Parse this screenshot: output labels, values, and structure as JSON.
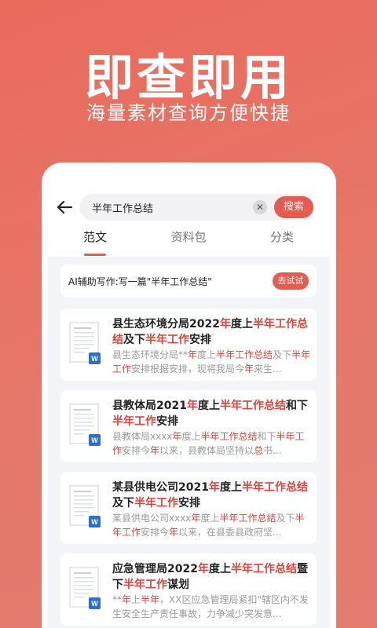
{
  "hero": {
    "title": "即查即用",
    "subtitle": "海量素材查询方便快捷"
  },
  "search": {
    "query": "半年工作总结",
    "clear_icon": "close-icon",
    "button_label": "搜索"
  },
  "tabs": [
    {
      "label": "范文",
      "active": true
    },
    {
      "label": "资料包",
      "active": false
    },
    {
      "label": "分类",
      "active": false
    }
  ],
  "ai_banner": {
    "text": "AI辅助写作:写一篇\"半年工作总结\"",
    "button_label": "去试试"
  },
  "accent_color": "#e25c50",
  "highlight_color": "#d8453a",
  "results": [
    {
      "title_parts": [
        {
          "t": "县生态环境分局2022",
          "h": false
        },
        {
          "t": "年",
          "h": true
        },
        {
          "t": "度上",
          "h": false
        },
        {
          "t": "半年工作总结",
          "h": true
        },
        {
          "t": "及下",
          "h": false
        },
        {
          "t": "半年工作",
          "h": true
        },
        {
          "t": "安排",
          "h": false
        }
      ],
      "snippet_parts": [
        {
          "t": "县生态环境分局**",
          "h": false
        },
        {
          "t": "年",
          "h": true
        },
        {
          "t": "度上",
          "h": false
        },
        {
          "t": "半年工作总结",
          "h": true
        },
        {
          "t": "及下",
          "h": false
        },
        {
          "t": "半年工作",
          "h": true
        },
        {
          "t": "安排根据安排，现将我局今",
          "h": false
        },
        {
          "t": "年",
          "h": true
        },
        {
          "t": "来生...",
          "h": false
        }
      ]
    },
    {
      "title_parts": [
        {
          "t": "县教体局2021",
          "h": false
        },
        {
          "t": "年",
          "h": true
        },
        {
          "t": "度上",
          "h": false
        },
        {
          "t": "半年工作总结",
          "h": true
        },
        {
          "t": "和下",
          "h": false
        },
        {
          "t": "半年工作",
          "h": true
        },
        {
          "t": "安排",
          "h": false
        }
      ],
      "snippet_parts": [
        {
          "t": "县教体局xxxx",
          "h": false
        },
        {
          "t": "年",
          "h": true
        },
        {
          "t": "度上",
          "h": false
        },
        {
          "t": "半年工作总结",
          "h": true
        },
        {
          "t": "和下",
          "h": false
        },
        {
          "t": "半年工作",
          "h": true
        },
        {
          "t": "安排今",
          "h": false
        },
        {
          "t": "年",
          "h": true
        },
        {
          "t": "以来，县教体局坚持以",
          "h": false
        },
        {
          "t": "总",
          "h": true
        },
        {
          "t": "书...",
          "h": false
        }
      ]
    },
    {
      "title_parts": [
        {
          "t": "某县供电公司2021",
          "h": false
        },
        {
          "t": "年",
          "h": true
        },
        {
          "t": "度上",
          "h": false
        },
        {
          "t": "半年工作总结",
          "h": true
        },
        {
          "t": "及下",
          "h": false
        },
        {
          "t": "半年工作",
          "h": true
        },
        {
          "t": "安排",
          "h": false
        }
      ],
      "snippet_parts": [
        {
          "t": "某县供电公司xxxx",
          "h": false
        },
        {
          "t": "年",
          "h": true
        },
        {
          "t": "度上",
          "h": false
        },
        {
          "t": "半年工作总结",
          "h": true
        },
        {
          "t": "及下",
          "h": false
        },
        {
          "t": "半年工作",
          "h": true
        },
        {
          "t": "安排今",
          "h": false
        },
        {
          "t": "年",
          "h": true
        },
        {
          "t": "以来，在县委县政府坚...",
          "h": false
        }
      ]
    },
    {
      "title_parts": [
        {
          "t": "应急管理局2022",
          "h": false
        },
        {
          "t": "年",
          "h": true
        },
        {
          "t": "度上",
          "h": false
        },
        {
          "t": "半年工作总结",
          "h": true
        },
        {
          "t": "暨下",
          "h": false
        },
        {
          "t": "半年工作",
          "h": true
        },
        {
          "t": "谋划",
          "h": false
        }
      ],
      "snippet_parts": [
        {
          "t": "**",
          "h": false
        },
        {
          "t": "年",
          "h": true
        },
        {
          "t": "上",
          "h": false
        },
        {
          "t": "半年",
          "h": true
        },
        {
          "t": "，XX区应急管理局紧扣\"辖区内不发生安全生产责任事故，力争减少突发意...",
          "h": false
        }
      ]
    }
  ]
}
